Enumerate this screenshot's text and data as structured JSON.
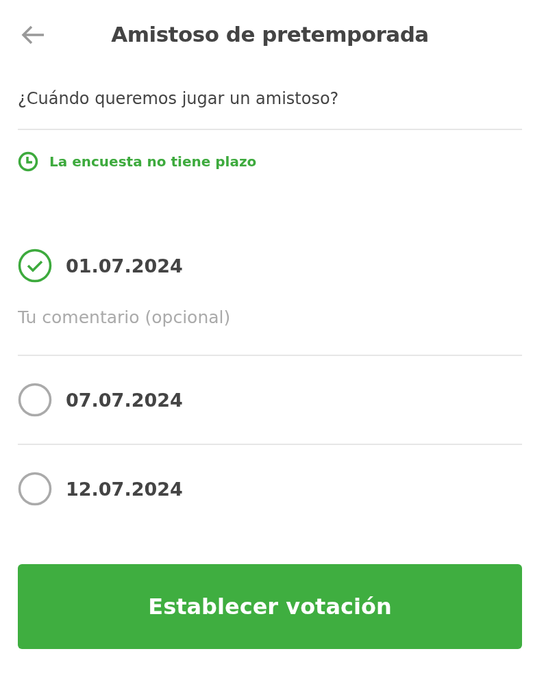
{
  "header": {
    "title": "Amistoso de pretemporada"
  },
  "question": "¿Cuándo queremos jugar un amistoso?",
  "deadline": "La encuesta no tiene plazo",
  "options": [
    {
      "label": "01.07.2024",
      "selected": true,
      "comment": {
        "placeholder": "Tu comentario (opcional)"
      }
    },
    {
      "label": "07.07.2024",
      "selected": false
    },
    {
      "label": "12.07.2024",
      "selected": false
    }
  ],
  "button": "Establecer votación"
}
